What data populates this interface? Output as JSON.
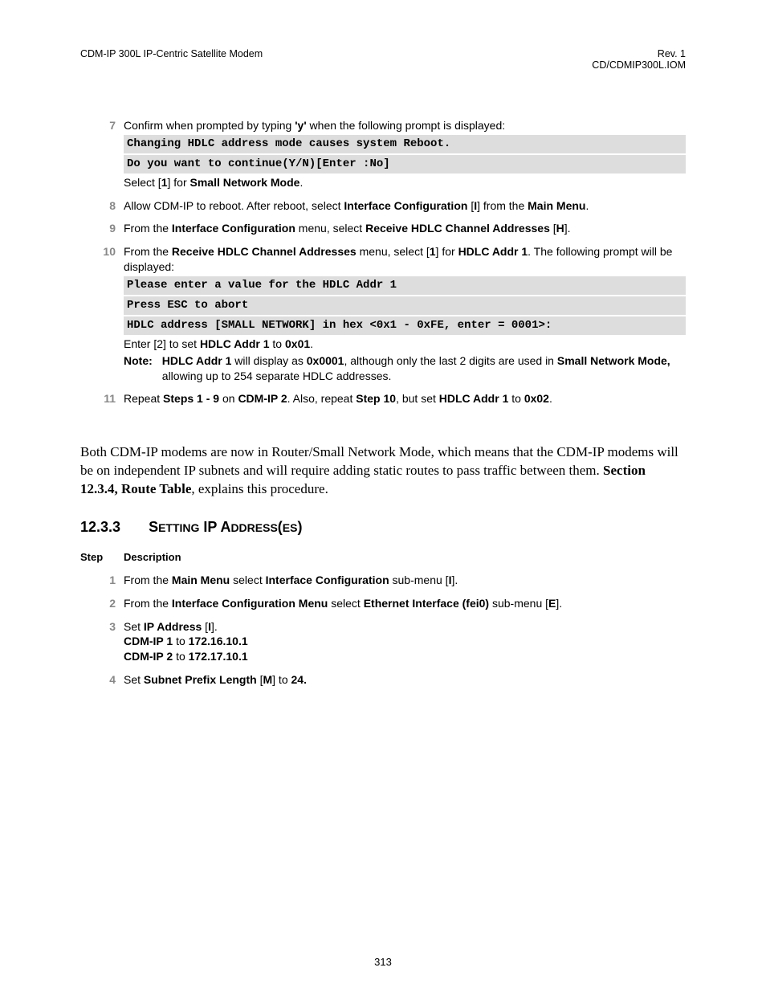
{
  "header": {
    "left": "CDM-IP 300L IP-Centric Satellite Modem",
    "right1": "Rev. 1",
    "right2": "CD/CDMIP300L.IOM"
  },
  "steps1": {
    "s7": {
      "num": "7",
      "pre": "Confirm when prompted by typing ",
      "q": "'y'",
      "post": " when the following prompt is displayed:",
      "code1": "Changing HDLC address mode causes system Reboot.",
      "code2": "Do you want to continue(Y/N)[Enter :No]",
      "after_a": "Select [",
      "after_b": "1",
      "after_c": "] for ",
      "after_d": "Small Network Mode",
      "after_e": "."
    },
    "s8": {
      "num": "8",
      "a": "Allow CDM-IP to reboot. After reboot, select ",
      "b": "Interface Configuration",
      "c": " [",
      "d": "I",
      "e": "] from the ",
      "f": "Main Menu",
      "g": "."
    },
    "s9": {
      "num": "9",
      "a": "From the ",
      "b": "Interface Configuration",
      "c": " menu, select ",
      "d": "Receive HDLC Channel Addresses",
      "e": " [",
      "f": "H",
      "g": "]."
    },
    "s10": {
      "num": "10",
      "a": "From the ",
      "b": "Receive HDLC Channel Addresses",
      "c": " menu, select [",
      "d": "1",
      "e": "] for ",
      "f": "HDLC Addr 1",
      "g": ". The following prompt will be displayed:",
      "code1": "Please enter a value for the HDLC Addr 1",
      "code2": "Press ESC to abort",
      "code3": "HDLC address [SMALL NETWORK] in hex <0x1 - 0xFE, enter = 0001>:",
      "after_a": "Enter [2] to set ",
      "after_b": "HDLC Addr 1",
      "after_c": " to ",
      "after_d": "0x01",
      "after_e": ".",
      "note_label": "Note:",
      "note_a": "HDLC Addr 1",
      "note_b": " will display as ",
      "note_c": "0x0001",
      "note_d": ", although only the last 2 digits are used in ",
      "note_e": "Small Network Mode,",
      "note_f": " allowing up to 254 separate HDLC addresses."
    },
    "s11": {
      "num": "11",
      "a": "Repeat ",
      "b": "Steps 1 - 9",
      "c": " on ",
      "d": "CDM-IP 2",
      "e": ". Also, repeat ",
      "f": "Step 10",
      "g": ", but set ",
      "h": "HDLC Addr 1",
      "i": " to ",
      "j": "0x02",
      "k": "."
    }
  },
  "body_p": {
    "a": "Both CDM-IP modems are now in Router/Small Network Mode, which means that the CDM-IP modems will be on independent IP subnets and will require adding static routes to pass traffic between them. ",
    "b": "Section 12.3.4, Route Table",
    "c": ", explains this procedure."
  },
  "section": {
    "num": "12.3.3",
    "title_a": "S",
    "title_b": "ETTING",
    "title_c": " IP A",
    "title_d": "DDRESS",
    "title_e": "(",
    "title_f": "ES",
    "title_g": ")"
  },
  "th": {
    "step": "Step",
    "desc": "Description"
  },
  "steps2": {
    "s1": {
      "num": "1",
      "a": "From the ",
      "b": "Main Menu",
      "c": " select ",
      "d": "Interface Configuration",
      "e": " sub-menu [",
      "f": "I",
      "g": "]."
    },
    "s2": {
      "num": "2",
      "a": "From the ",
      "b": "Interface Configuration Menu",
      "c": " select ",
      "d": "Ethernet Interface (fei0)",
      "e": " sub-menu [",
      "f": "E",
      "g": "]."
    },
    "s3": {
      "num": "3",
      "a": "Set ",
      "b": "IP Address",
      "c": " [",
      "d": "I",
      "e": "].",
      "l2a": "CDM-IP 1",
      "l2b": " to ",
      "l2c": "172.16.10.1",
      "l3a": "CDM-IP 2",
      "l3b": " to ",
      "l3c": "172.17.10.1"
    },
    "s4": {
      "num": "4",
      "a": "Set ",
      "b": "Subnet Prefix Length",
      "c": " [",
      "d": "M",
      "e": "] to ",
      "f": "24."
    }
  },
  "footer": "313"
}
